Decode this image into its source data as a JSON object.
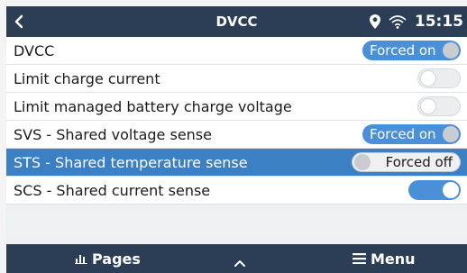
{
  "header": {
    "title": "DVCC",
    "time": "15:15",
    "icons": [
      "back-chevron-icon",
      "location-pin-icon",
      "wifi-icon"
    ]
  },
  "settings": [
    {
      "label": "DVCC",
      "control": "Forced on",
      "state": "on"
    },
    {
      "label": "Limit charge current",
      "control": "",
      "state": "off"
    },
    {
      "label": "Limit managed battery charge voltage",
      "control": "",
      "state": "off"
    },
    {
      "label": "SVS - Shared voltage sense",
      "control": "Forced on",
      "state": "on"
    },
    {
      "label": "STS - Shared temperature sense",
      "control": "Forced off",
      "state": "off",
      "selected": true
    },
    {
      "label": "SCS - Shared current sense",
      "control": "",
      "state": "on"
    }
  ],
  "footer": {
    "pages_label": "Pages",
    "menu_label": "Menu"
  },
  "colors": {
    "header_bg": "#2c3e55",
    "accent": "#4a90d9",
    "selected_row": "#3b7fc4"
  }
}
